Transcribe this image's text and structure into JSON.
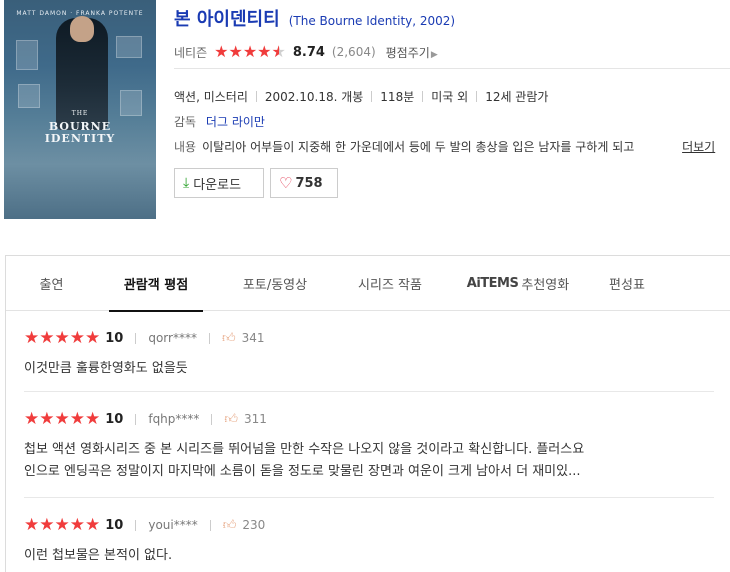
{
  "poster": {
    "top_names": "MATT DAMON · FRANKA POTENTE",
    "title_small": "THE",
    "title_line1": "BOURNE",
    "title_line2": "IDENTITY"
  },
  "movie": {
    "title": "본 아이덴티티",
    "original_title": "(The Bourne Identity, 2002)",
    "rating_label": "네티즌",
    "score": "8.74",
    "votes": "(2,604)",
    "rate_link": "평점주기",
    "genres": "액션, 미스터리",
    "release": "2002.10.18. 개봉",
    "runtime": "118분",
    "country": "미국 외",
    "age": "12세 관람가",
    "director_label": "감독",
    "director": "더그 라이만",
    "plot_label": "내용",
    "plot": "이탈리아 어부들이 지중해 한 가운데에서 등에 두 발의 총상을 입은 남자를 구하게 되고",
    "more_label": "더보기",
    "download_label": "다운로드",
    "like_count": "758"
  },
  "tabs": [
    {
      "label": "출연"
    },
    {
      "label": "관람객 평점"
    },
    {
      "label": "포토/동영상"
    },
    {
      "label": "시리즈 작품"
    },
    {
      "brand": "AiTEMS",
      "label": "추천영화"
    },
    {
      "label": "편성표"
    }
  ],
  "reviews": [
    {
      "score": "10",
      "user": "qorr****",
      "likes": "341",
      "text": "이것만큼 훌륭한영화도 없을듯"
    },
    {
      "score": "10",
      "user": "fqhp****",
      "likes": "311",
      "text_line1": "첩보 액션 영화시리즈 중 본 시리즈를 뛰어넘을 만한 수작은 나오지 않을 것이라고 확신합니다. 플러스요",
      "text_line2": "인으로 엔딩곡은 정말이지 마지막에 소름이 돋을 정도로 맞물린 장면과 여운이 크게 남아서 더 재미있..."
    },
    {
      "score": "10",
      "user": "youi****",
      "likes": "230",
      "text": "이런 첩보물은 본적이 없다."
    }
  ],
  "colors": {
    "star": "#f03c3c",
    "link": "#1a3bb3",
    "download": "#2aa12a",
    "heart": "#e0314b"
  },
  "icons": {
    "download": "download-arrow-icon",
    "like": "heart-icon",
    "thumb": "thumbs-up-icon",
    "star": "star-icon"
  }
}
